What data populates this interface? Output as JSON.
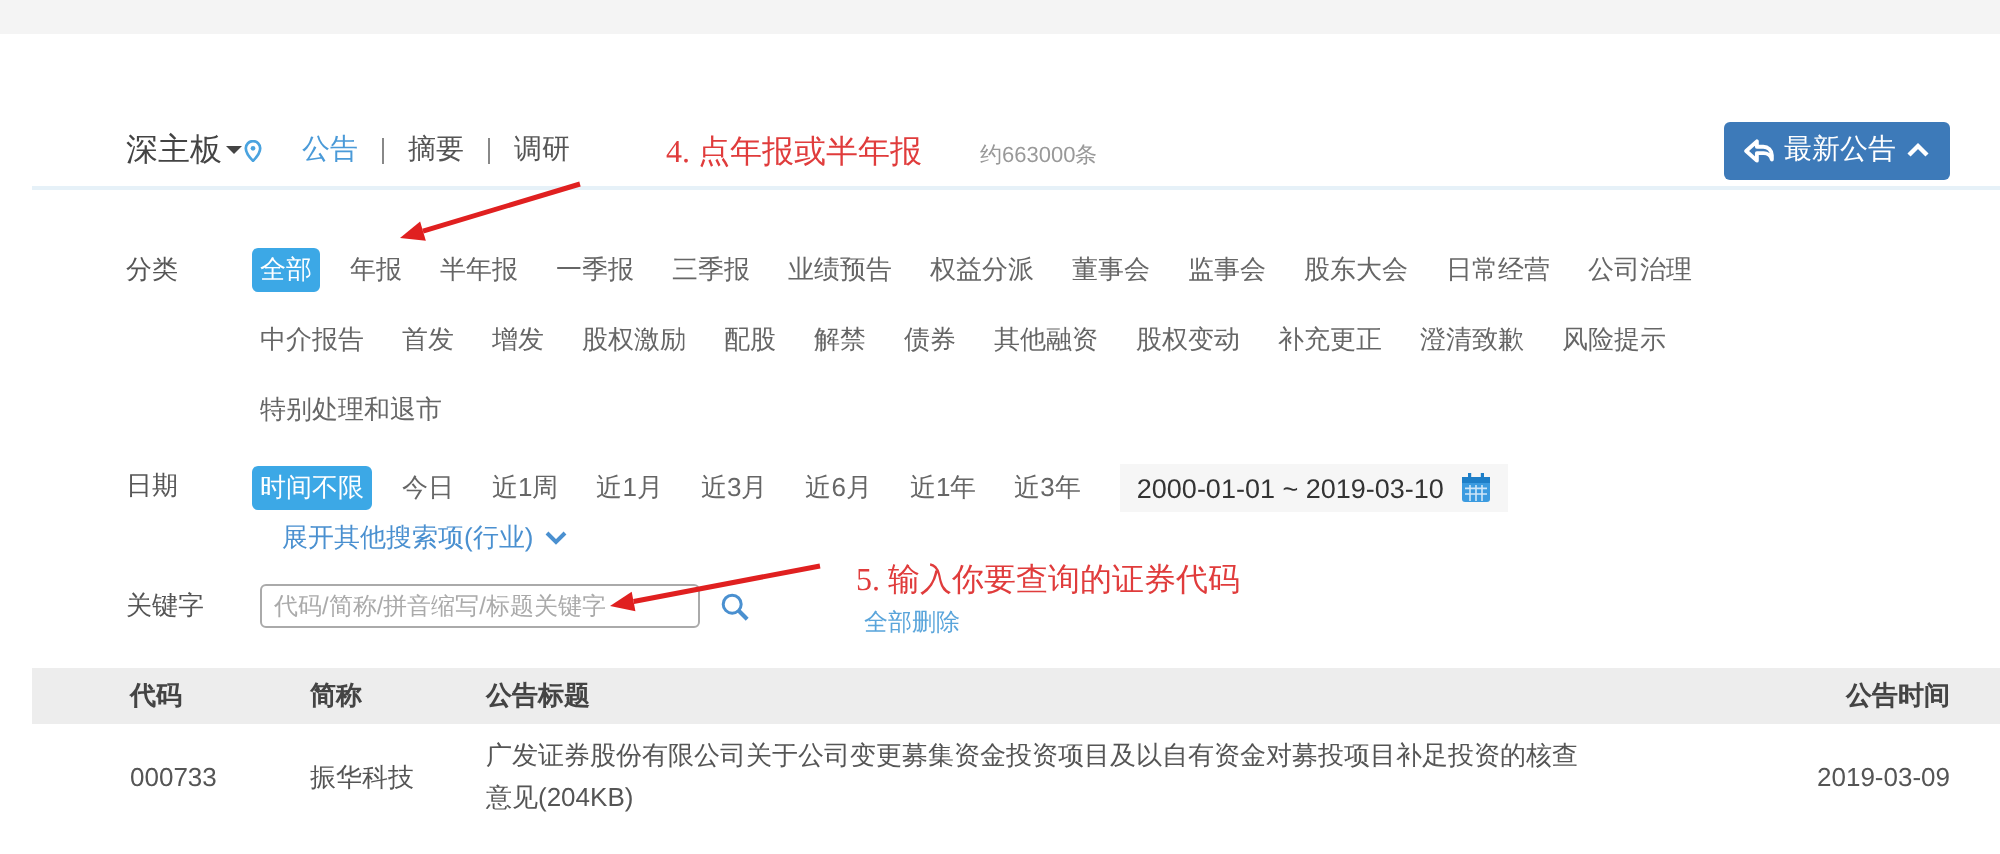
{
  "header": {
    "market": "深主板",
    "tabs": [
      {
        "label": "公告",
        "selected": true
      },
      {
        "label": "摘要",
        "selected": false
      },
      {
        "label": "调研",
        "selected": false
      }
    ],
    "count": "约663000条",
    "latest_button": "最新公告"
  },
  "category": {
    "label": "分类",
    "rows": [
      {
        "items": [
          {
            "label": "全部",
            "selected": true
          },
          {
            "label": "年报",
            "selected": false
          },
          {
            "label": "半年报",
            "selected": false
          },
          {
            "label": "一季报",
            "selected": false
          },
          {
            "label": "三季报",
            "selected": false
          },
          {
            "label": "业绩预告",
            "selected": false
          },
          {
            "label": "权益分派",
            "selected": false
          },
          {
            "label": "董事会",
            "selected": false
          },
          {
            "label": "监事会",
            "selected": false
          },
          {
            "label": "股东大会",
            "selected": false
          },
          {
            "label": "日常经营",
            "selected": false
          },
          {
            "label": "公司治理",
            "selected": false
          }
        ]
      },
      {
        "items": [
          {
            "label": "中介报告",
            "selected": false
          },
          {
            "label": "首发",
            "selected": false
          },
          {
            "label": "增发",
            "selected": false
          },
          {
            "label": "股权激励",
            "selected": false
          },
          {
            "label": "配股",
            "selected": false
          },
          {
            "label": "解禁",
            "selected": false
          },
          {
            "label": "债券",
            "selected": false
          },
          {
            "label": "其他融资",
            "selected": false
          },
          {
            "label": "股权变动",
            "selected": false
          },
          {
            "label": "补充更正",
            "selected": false
          },
          {
            "label": "澄清致歉",
            "selected": false
          },
          {
            "label": "风险提示",
            "selected": false
          }
        ]
      },
      {
        "items": [
          {
            "label": "特别处理和退市",
            "selected": false
          }
        ]
      }
    ]
  },
  "date": {
    "label": "日期",
    "items": [
      {
        "label": "时间不限",
        "selected": true
      },
      {
        "label": "今日",
        "selected": false
      },
      {
        "label": "近1周",
        "selected": false
      },
      {
        "label": "近1月",
        "selected": false
      },
      {
        "label": "近3月",
        "selected": false
      },
      {
        "label": "近6月",
        "selected": false
      },
      {
        "label": "近1年",
        "selected": false
      },
      {
        "label": "近3年",
        "selected": false
      }
    ],
    "range": "2000-01-01 ~ 2019-03-10"
  },
  "expand_link": "展开其他搜索项(行业)",
  "keyword": {
    "label": "关键字",
    "placeholder": "代码/简称/拼音缩写/标题关键字",
    "clear_link": "全部删除"
  },
  "table": {
    "columns": [
      "代码",
      "简称",
      "公告标题",
      "公告时间"
    ],
    "rows": [
      {
        "cells": [
          "000733",
          "振华科技",
          "广发证券股份有限公司关于公司变更募集资金投资项目及以自有资金对募投项目补足投资的核查意见(204KB)",
          "2019-03-09"
        ]
      }
    ]
  },
  "annotations": [
    {
      "text": "4. 点年报或半年报",
      "kind": "step4"
    },
    {
      "text": "5. 输入你要查询的证券代码",
      "kind": "step5"
    }
  ]
}
